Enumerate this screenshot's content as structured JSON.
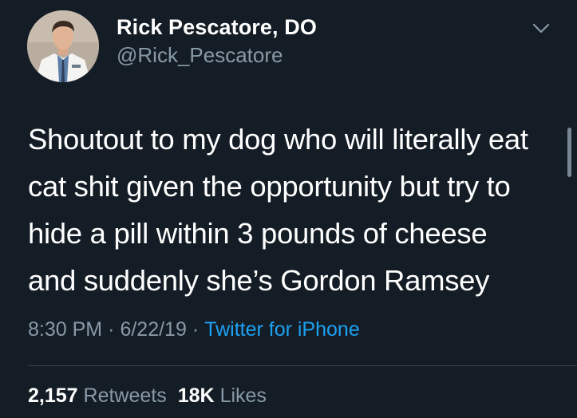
{
  "author": {
    "display_name": "Rick Pescatore, DO",
    "handle": "@Rick_Pescatore"
  },
  "tweet": {
    "text": "Shoutout to my dog who will literally eat\ncat shit given the opportunity but try to\nhide a pill within 3 pounds of cheese\nand suddenly she’s Gordon Ramsey",
    "time": "8:30 PM",
    "date": "6/22/19",
    "separator": "·",
    "source": "Twitter for iPhone"
  },
  "stats": {
    "retweets_count": "2,157",
    "retweets_label": "Retweets",
    "likes_count": "18K",
    "likes_label": "Likes"
  },
  "icons": {
    "menu": "chevron-down-icon"
  },
  "colors": {
    "background": "#141d26",
    "primary_text": "#ffffff",
    "secondary_text": "#8899a6",
    "link": "#1da1f2",
    "divider": "#38444d"
  }
}
